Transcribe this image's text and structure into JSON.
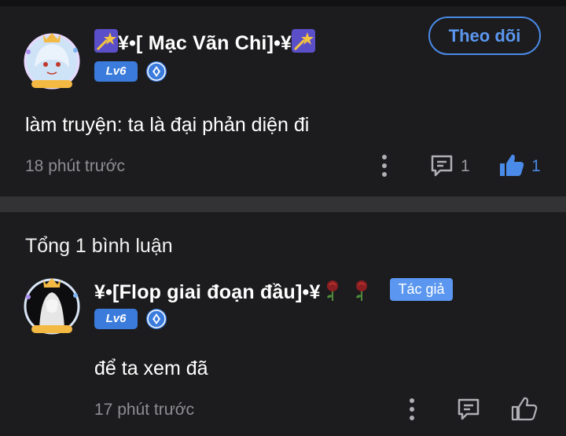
{
  "post": {
    "username": "¥•[ Mạc Vãn Chi]•¥",
    "level": "Lv6",
    "follow_label": "Theo dõi",
    "content": "làm truyện: ta là đại phản diện đi",
    "time": "18 phút trước",
    "reply_count": "1",
    "like_count": "1"
  },
  "comments_section": {
    "total_label": "Tổng 1 bình luận"
  },
  "comment": {
    "username": "¥•[Flop giai đoạn đầu]•¥",
    "author_badge": "Tác giả",
    "level": "Lv6",
    "content": "để ta xem đã",
    "time": "17 phút trước"
  },
  "colors": {
    "accent": "#4a8ae8",
    "background": "#1c1c1e",
    "divider": "#333336",
    "muted": "#8e8e93"
  },
  "icons": [
    "shooting-star-icon",
    "rose-icon",
    "gem-icon",
    "more-vertical-icon",
    "reply-icon",
    "thumbs-up-icon"
  ]
}
